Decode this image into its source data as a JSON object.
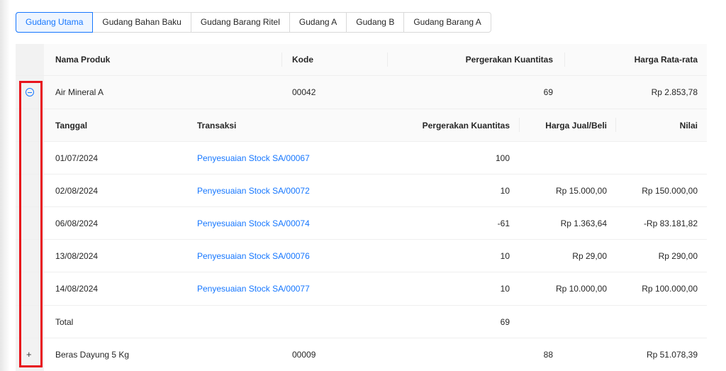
{
  "tabs": [
    {
      "label": "Gudang Utama",
      "active": true
    },
    {
      "label": "Gudang Bahan Baku",
      "active": false
    },
    {
      "label": "Gudang Barang Ritel",
      "active": false
    },
    {
      "label": "Gudang A",
      "active": false
    },
    {
      "label": "Gudang B",
      "active": false
    },
    {
      "label": "Gudang Barang A",
      "active": false
    }
  ],
  "main_table": {
    "headers": {
      "name": "Nama Produk",
      "code": "Kode",
      "movement": "Pergerakan Kuantitas",
      "avg_price": "Harga Rata-rata"
    },
    "products": [
      {
        "name": "Air Mineral A",
        "code": "00042",
        "movement": "69",
        "avg_price": "Rp 2.853,78",
        "expanded": true
      },
      {
        "name": "Beras Dayung 5 Kg",
        "code": "00009",
        "movement": "88",
        "avg_price": "Rp 51.078,39",
        "expanded": false
      }
    ]
  },
  "detail_table": {
    "headers": {
      "date": "Tanggal",
      "transaction": "Transaksi",
      "movement": "Pergerakan Kuantitas",
      "price": "Harga Jual/Beli",
      "value": "Nilai"
    },
    "rows": [
      {
        "date": "01/07/2024",
        "transaction": "Penyesuaian Stock SA/00067",
        "movement": "100",
        "price": "",
        "value": ""
      },
      {
        "date": "02/08/2024",
        "transaction": "Penyesuaian Stock SA/00072",
        "movement": "10",
        "price": "Rp 15.000,00",
        "value": "Rp 150.000,00"
      },
      {
        "date": "06/08/2024",
        "transaction": "Penyesuaian Stock SA/00074",
        "movement": "-61",
        "price": "Rp 1.363,64",
        "value": "-Rp 83.181,82"
      },
      {
        "date": "13/08/2024",
        "transaction": "Penyesuaian Stock SA/00076",
        "movement": "10",
        "price": "Rp 29,00",
        "value": "Rp 290,00"
      },
      {
        "date": "14/08/2024",
        "transaction": "Penyesuaian Stock SA/00077",
        "movement": "10",
        "price": "Rp 10.000,00",
        "value": "Rp 100.000,00"
      }
    ],
    "total": {
      "label": "Total",
      "movement": "69"
    }
  },
  "colors": {
    "accent": "#1677ff",
    "highlight": "#e8121b"
  },
  "icons": {
    "collapse": "minus-circle-icon",
    "expand": "plus-icon"
  }
}
